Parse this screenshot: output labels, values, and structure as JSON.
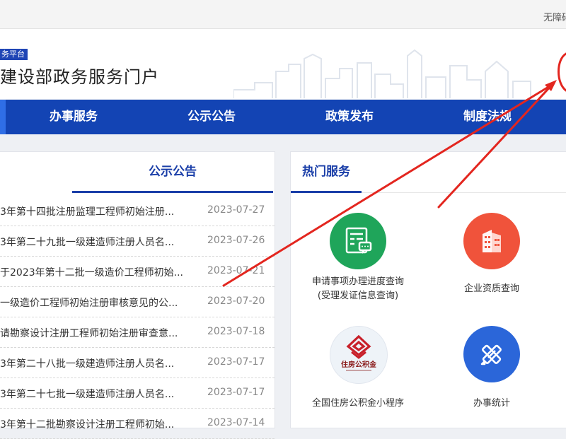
{
  "topbar": {
    "accessibility_text": "无障碍"
  },
  "header": {
    "badge": "务平台",
    "title": "建设部政务服务门户"
  },
  "nav": {
    "items": [
      {
        "label": "办事服务"
      },
      {
        "label": "公示公告"
      },
      {
        "label": "政策发布"
      },
      {
        "label": "制度法规"
      }
    ]
  },
  "notices": {
    "tab_label": "公示公告",
    "items": [
      {
        "title": "3年第十四批注册监理工程师初始注册...",
        "date": "2023-07-27"
      },
      {
        "title": "3年第二十九批一级建造师注册人员名...",
        "date": "2023-07-26"
      },
      {
        "title": "于2023年第十二批一级造价工程师初始...",
        "date": "2023-07-21"
      },
      {
        "title": "一级造价工程师初始注册审核意见的公...",
        "date": "2023-07-20"
      },
      {
        "title": "请勘察设计注册工程师初始注册审查意...",
        "date": "2023-07-18"
      },
      {
        "title": "3年第二十八批一级建造师注册人员名...",
        "date": "2023-07-17"
      },
      {
        "title": "3年第二十七批一级建造师注册人员名...",
        "date": "2023-07-17"
      },
      {
        "title": "3年第十二批勘察设计注册工程师初始...",
        "date": "2023-07-14"
      }
    ]
  },
  "hot_services": {
    "title": "热门服务",
    "items": [
      {
        "label_line1": "申请事项办理进度查询",
        "label_line2": "(受理发证信息查询)",
        "icon": "form-chat-icon",
        "color": "#1fa55a"
      },
      {
        "label_line1": "企业资质查询",
        "label_line2": "",
        "icon": "building-icon",
        "color": "#f0533b"
      },
      {
        "label_line1": "全国住房公积金小程序",
        "label_line2": "",
        "icon": "housing-fund-logo",
        "logo_text": "住房公积金",
        "color": "#c8202a"
      },
      {
        "label_line1": "办事统计",
        "label_line2": "",
        "icon": "statistics-tools-icon",
        "color": "#2b66d9"
      }
    ]
  },
  "colors": {
    "nav_bg": "#1344b4",
    "accent_blue": "#1a3ea8",
    "annotation_red": "#e3261f"
  }
}
